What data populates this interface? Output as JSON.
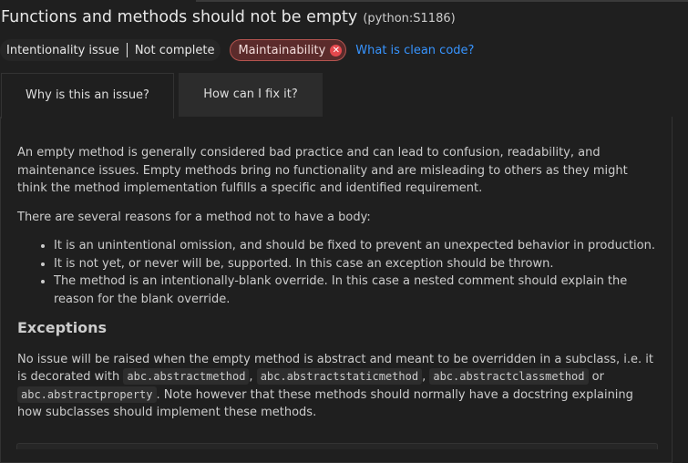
{
  "header": {
    "title": "Functions and methods should not be empty",
    "rule_key": "(python:S1186)"
  },
  "attributes": {
    "category": "Intentionality issue",
    "attribute": "Not complete"
  },
  "impact": {
    "label": "Maintainability",
    "icon": "severity-high-icon",
    "color": "#e5484d"
  },
  "clean_code_link": "What is clean code?",
  "tabs": [
    {
      "label": "Why is this an issue?",
      "active": true
    },
    {
      "label": "How can I fix it?",
      "active": false
    }
  ],
  "content": {
    "intro": "An empty method is generally considered bad practice and can lead to confusion, readability, and maintenance issues. Empty methods bring no functionality and are misleading to others as they might think the method implementation fulfills a specific and identified requirement.",
    "reasons_intro": "There are several reasons for a method not to have a body:",
    "reasons": [
      "It is an unintentional omission, and should be fixed to prevent an unexpected behavior in production.",
      "It is not yet, or never will be, supported. In this case an exception should be thrown.",
      "The method is an intentionally-blank override. In this case a nested comment should explain the reason for the blank override."
    ],
    "exceptions_heading": "Exceptions",
    "exceptions": {
      "text_1": "No issue will be raised when the empty method is abstract and meant to be overridden in a subclass, i.e. it is decorated with ",
      "code_1": "abc.abstractmethod",
      "sep_1": ", ",
      "code_2": "abc.abstractstaticmethod",
      "sep_2": ", ",
      "code_3": "abc.abstractclassmethod",
      "sep_3": " or ",
      "code_4": "abc.abstractproperty",
      "text_2": ". Note however that these methods should normally have a docstring explaining how subclasses should implement these methods."
    }
  }
}
